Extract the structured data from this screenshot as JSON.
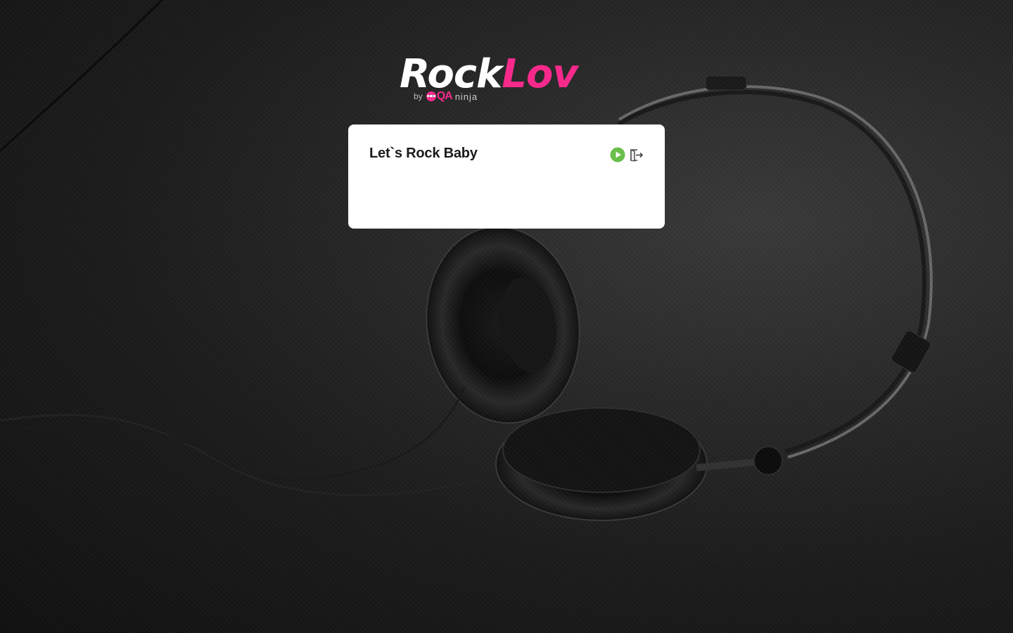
{
  "brand": {
    "name_part1": "Rock",
    "name_part2": "Lov",
    "by_label": "by",
    "partner_mark": "QA",
    "partner_name": "ninja",
    "accent_color": "#f72a8c"
  },
  "card": {
    "title": "Let`s Rock Baby",
    "actions": [
      {
        "name": "play",
        "icon": "play-circle-icon",
        "color": "#6abf4b"
      },
      {
        "name": "logout",
        "icon": "logout-icon",
        "color": "#444444"
      }
    ]
  },
  "background": {
    "subject": "headphones-photo"
  }
}
